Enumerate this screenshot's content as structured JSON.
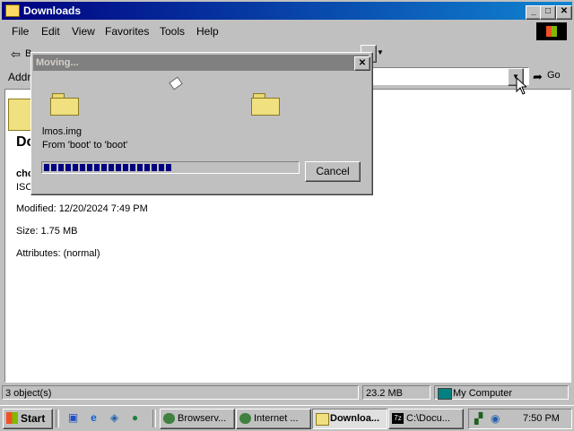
{
  "window": {
    "title": "Downloads"
  },
  "menu": {
    "items": [
      "File",
      "Edit",
      "View",
      "Favorites",
      "Tools",
      "Help"
    ]
  },
  "toolbar": {
    "back_label": "B"
  },
  "address": {
    "label": "Addr",
    "go_label": "Go"
  },
  "info_panel": {
    "title_partial": "Do",
    "filename_partial": "cho",
    "type_partial": "ISC",
    "modified": "Modified: 12/20/2024 7:49 PM",
    "size": "Size: 1.75 MB",
    "attributes": "Attributes: (normal)"
  },
  "statusbar": {
    "objects": "3 object(s)",
    "size": "23.2 MB",
    "zone": "My Computer"
  },
  "dialog": {
    "title": "Moving...",
    "file": "lmos.img",
    "from_to": "From 'boot' to 'boot'",
    "cancel_label": "Cancel",
    "progress": 0.51
  },
  "taskbar": {
    "start_label": "Start",
    "tasks": [
      {
        "label": "Browserv..."
      },
      {
        "label": "Internet ..."
      },
      {
        "label": "Downloa..."
      },
      {
        "label": "C:\\Docu..."
      }
    ],
    "clock": "7:50 PM"
  }
}
